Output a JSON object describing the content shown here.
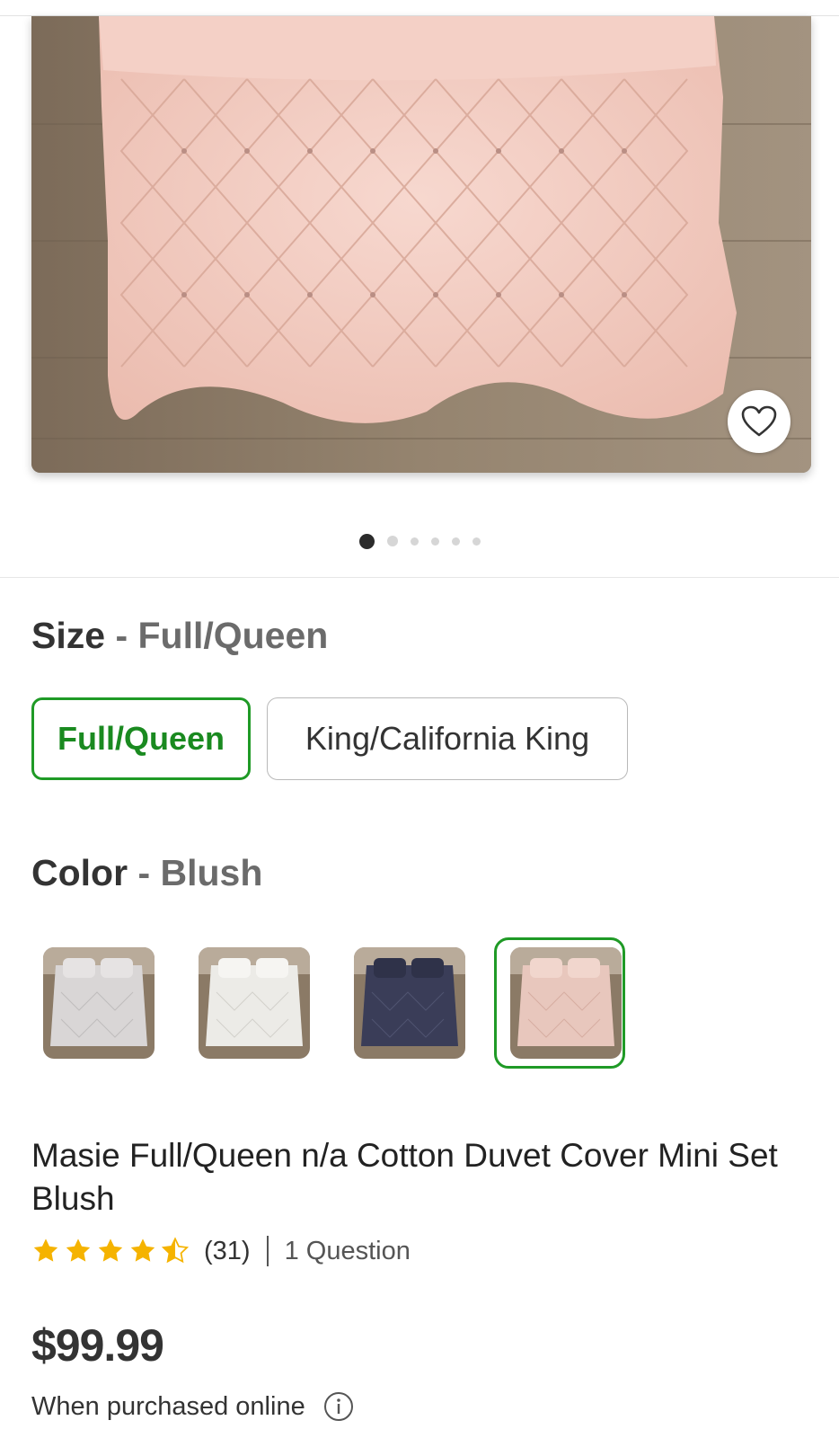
{
  "gallery": {
    "image_description_icon": "product-image",
    "favorite_icon": "heart-icon",
    "page_indicator": {
      "total": 6,
      "active": 1
    }
  },
  "size": {
    "label": "Size",
    "separator": " - ",
    "selected_value": "Full/Queen",
    "options": [
      {
        "label": "Full/Queen",
        "selected": true
      },
      {
        "label": "King/California King",
        "selected": false
      }
    ]
  },
  "color": {
    "label": "Color",
    "separator": " - ",
    "selected_value": "Blush",
    "swatch_colors": [
      "#d9d6d6",
      "#ecebe7",
      "#3a3d58",
      "#e8c7bd"
    ],
    "selected_index": 3
  },
  "product": {
    "title": "Masie Full/Queen n/a Cotton Duvet Cover Mini Set Blush",
    "rating": 4.5,
    "review_count": "(31)",
    "questions": "1 Question",
    "price": "$99.99",
    "price_note": "When purchased online"
  },
  "colors": {
    "accent_green": "#1f9a26",
    "star_yellow": "#f5b300"
  }
}
